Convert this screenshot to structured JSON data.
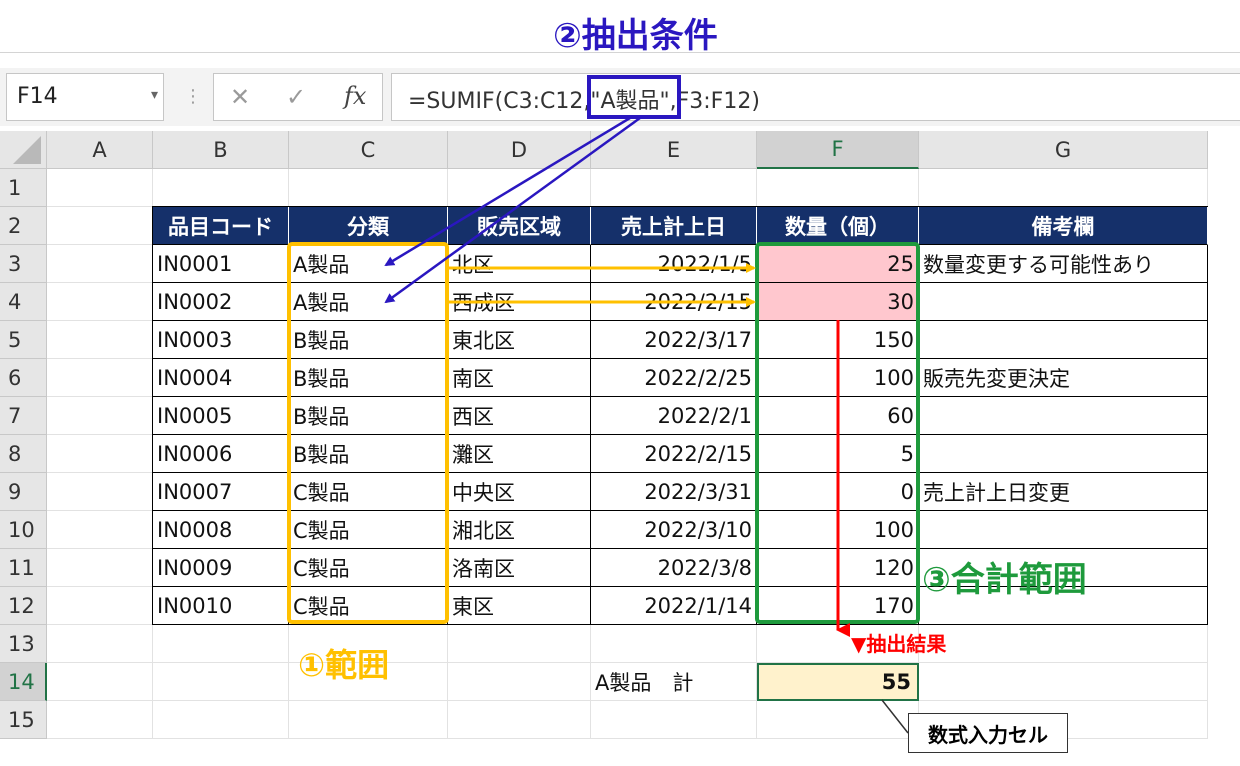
{
  "name_box": {
    "value": "F14",
    "dropdown_icon": "chevron-down-icon"
  },
  "formula_bar": {
    "cancel_icon": "close-icon",
    "confirm_icon": "check-icon",
    "fx_label": "fx",
    "formula": "=SUMIF(C3:C12,\"A製品\",F3:F12)"
  },
  "columns": [
    "A",
    "B",
    "C",
    "D",
    "E",
    "F",
    "G"
  ],
  "rows": [
    "1",
    "2",
    "3",
    "4",
    "5",
    "6",
    "7",
    "8",
    "9",
    "10",
    "11",
    "12",
    "13",
    "14",
    "15"
  ],
  "table": {
    "headers": [
      "品目コード",
      "分類",
      "販売区域",
      "売上計上日",
      "数量（個）",
      "備考欄"
    ],
    "rows": [
      [
        "IN0001",
        "A製品",
        "北区",
        "2022/1/5",
        "25",
        "数量変更する可能性あり"
      ],
      [
        "IN0002",
        "A製品",
        "西成区",
        "2022/2/15",
        "30",
        ""
      ],
      [
        "IN0003",
        "B製品",
        "東北区",
        "2022/3/17",
        "150",
        ""
      ],
      [
        "IN0004",
        "B製品",
        "南区",
        "2022/2/25",
        "100",
        "販売先変更決定"
      ],
      [
        "IN0005",
        "B製品",
        "西区",
        "2022/2/1",
        "60",
        ""
      ],
      [
        "IN0006",
        "B製品",
        "灘区",
        "2022/2/15",
        "5",
        ""
      ],
      [
        "IN0007",
        "C製品",
        "中央区",
        "2022/3/31",
        "0",
        "売上計上日変更"
      ],
      [
        "IN0008",
        "C製品",
        "湘北区",
        "2022/3/10",
        "100",
        ""
      ],
      [
        "IN0009",
        "C製品",
        "洛南区",
        "2022/3/8",
        "120",
        ""
      ],
      [
        "IN0010",
        "C製品",
        "東区",
        "2022/1/14",
        "170",
        ""
      ]
    ]
  },
  "total": {
    "label": "A製品　計",
    "value": "55"
  },
  "annotations": {
    "criteria": "②抽出条件",
    "range": "①範囲",
    "sum_range": "③合計範囲",
    "result": "▼抽出結果",
    "input_cell": "数式入力セル"
  },
  "colors": {
    "criteria": "#2a17c0",
    "range": "#ffc000",
    "sum_range": "#1e9a3c",
    "result": "#ff0000",
    "header_fill": "#15306a",
    "match_fill": "#ffc7ce",
    "result_fill": "#fff2cc"
  }
}
